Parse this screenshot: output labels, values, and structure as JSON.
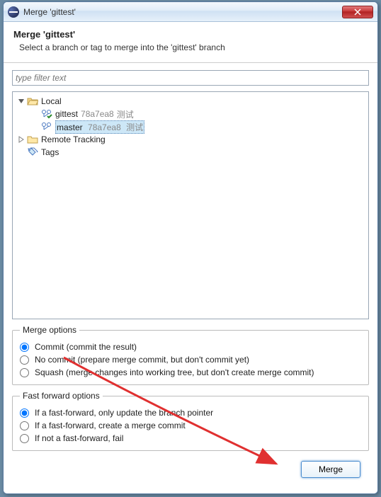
{
  "window": {
    "title": "Merge 'gittest'"
  },
  "header": {
    "title": "Merge 'gittest'",
    "subtitle": "Select a branch or tag to merge into the 'gittest' branch"
  },
  "filter": {
    "placeholder": "type filter text"
  },
  "tree": {
    "local": {
      "label": "Local"
    },
    "gittest": {
      "name": "gittest",
      "hash": "78a7ea8",
      "desc": "测试"
    },
    "master": {
      "name": "master",
      "hash": "78a7ea8",
      "desc": "测试"
    },
    "remote": {
      "label": "Remote Tracking"
    },
    "tags": {
      "label": "Tags"
    }
  },
  "merge_options": {
    "legend": "Merge options",
    "opt_commit": "Commit (commit the result)",
    "opt_nocommit": "No commit (prepare merge commit, but don't commit yet)",
    "opt_squash": "Squash (merge changes into working tree, but don't create merge commit)"
  },
  "ff_options": {
    "legend": "Fast forward options",
    "opt_ff": "If a fast-forward, only update the branch pointer",
    "opt_noff": "If a fast-forward, create a merge commit",
    "opt_ffonly": "If not a fast-forward, fail"
  },
  "buttons": {
    "merge": "Merge"
  }
}
